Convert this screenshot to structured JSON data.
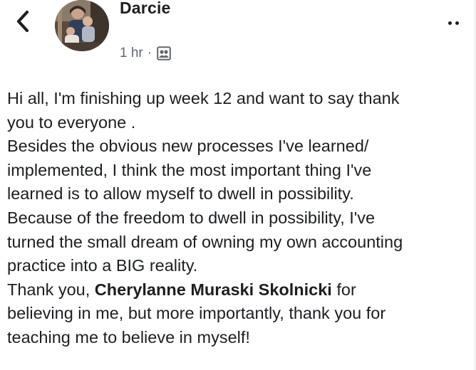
{
  "header": {
    "author_name": "Darcie",
    "timestamp": "1 hr",
    "separator": "·",
    "audience_icon": "group-audience-icon",
    "back_icon": "chevron-left-icon",
    "more_icon": "more-options-icon",
    "avatar_label": "profile-photo"
  },
  "post": {
    "lines": [
      {
        "text": "Hi all, I'm finishing up week 12 and want to say thank"
      },
      {
        "text": "you to everyone ."
      },
      {
        "text": "Besides the obvious new processes I've learned/"
      },
      {
        "text": "implemented, I think the most important thing I've"
      },
      {
        "text": "learned is to allow myself to dwell in possibility."
      },
      {
        "text": "Because of the freedom to dwell in possibility, I've"
      },
      {
        "text": "turned the small dream of owning my own accounting"
      },
      {
        "text": "practice into a BIG reality."
      },
      {
        "prefix": "Thank you, ",
        "mention": "Cherylanne Muraski Skolnicki",
        "suffix": " for"
      },
      {
        "text": "believing in me, but more importantly, thank you for"
      },
      {
        "text": "teaching me to believe in myself!"
      }
    ]
  },
  "colors": {
    "text": "#1c1e21",
    "meta": "#606770",
    "background": "#ffffff"
  }
}
